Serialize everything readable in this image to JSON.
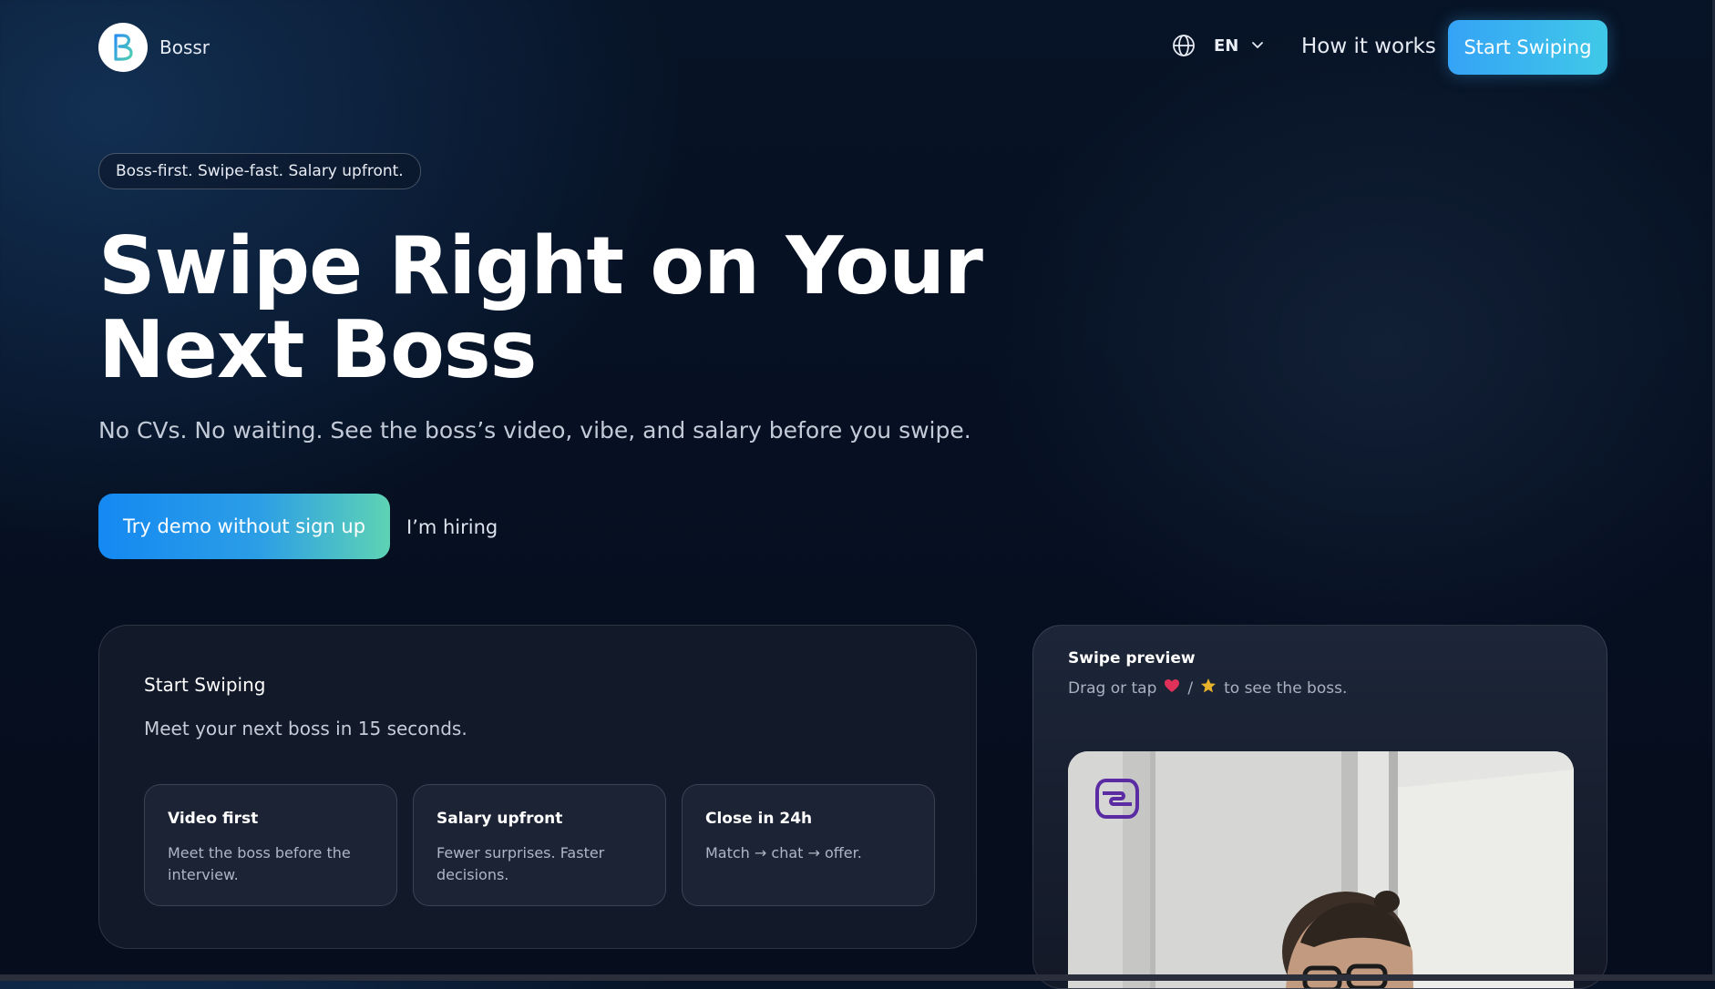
{
  "header": {
    "brand": "Bossr",
    "language_code": "EN",
    "how_it_works": "How it works",
    "cta_label": "Start Swiping"
  },
  "hero": {
    "pill": "Boss-first. Swipe-fast. Salary upfront.",
    "title": "Swipe Right on Your Next Boss",
    "subtitle": "No CVs. No waiting. See the boss’s video, vibe, and salary before you swipe.",
    "primary_cta": "Try demo without sign up",
    "secondary_cta": "I’m hiring"
  },
  "start_card": {
    "title": "Start Swiping",
    "subtitle": "Meet your next boss in 15 seconds.",
    "features": [
      {
        "title": "Video first",
        "desc": "Meet the boss before the interview."
      },
      {
        "title": "Salary upfront",
        "desc": "Fewer surprises. Faster decisions."
      },
      {
        "title": "Close in 24h",
        "desc": "Match → chat → offer."
      }
    ]
  },
  "preview_card": {
    "title": "Swipe preview",
    "hint_prefix": "Drag or tap",
    "hint_separator": "/",
    "hint_suffix": "to see the boss."
  },
  "icons": {
    "logo": "bossr-logo-icon",
    "language": "globe-icon",
    "dropdown": "chevron-down-icon",
    "like": "heart-icon",
    "super_like": "star-icon",
    "company": "company-logo-icon"
  },
  "colors": {
    "accent_blue": "#35a3f6",
    "accent_teal": "#5ed3b4",
    "background": "#061022",
    "heart": "#e0315a",
    "star": "#e8b32a",
    "company_logo": "#5a2ba3"
  }
}
